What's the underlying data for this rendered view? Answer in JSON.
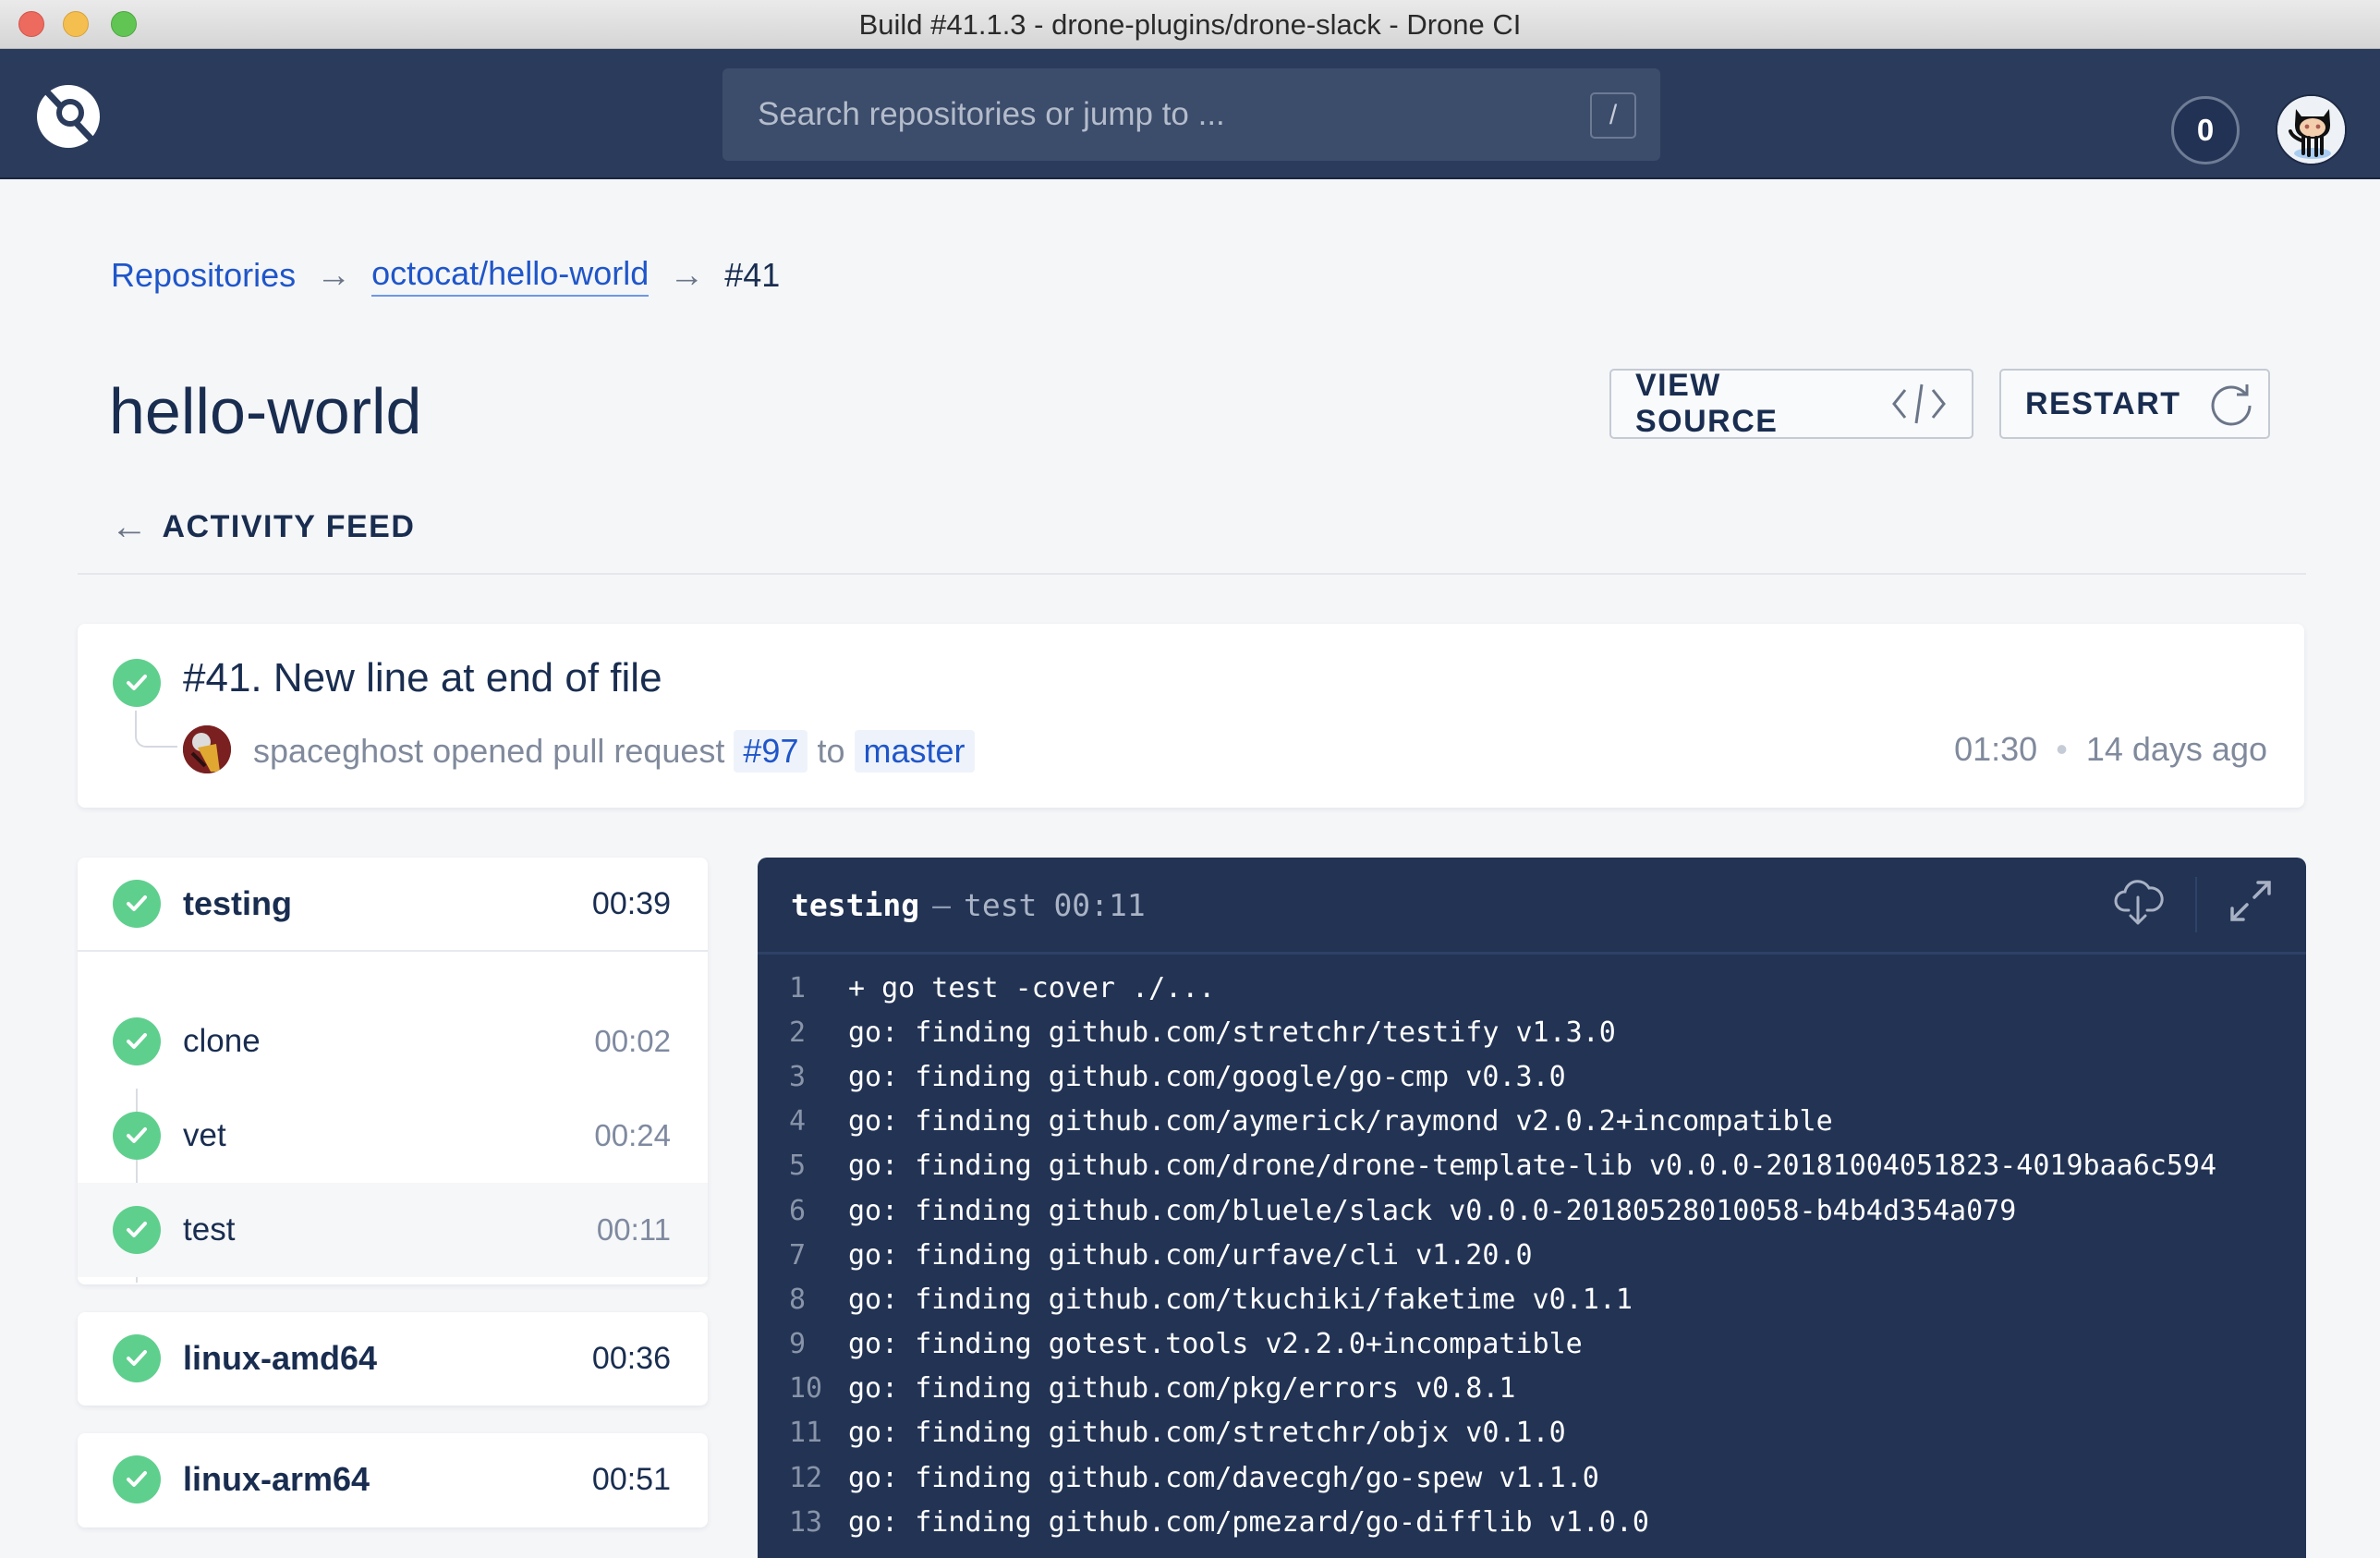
{
  "window": {
    "title": "Build #41.1.3 - drone-plugins/drone-slack - Drone CI"
  },
  "navbar": {
    "logo": "drone-logo-icon",
    "search_placeholder": "Search repositories or jump to ...",
    "search_shortcut": "/",
    "notification_count": "0",
    "avatar": "octocat-avatar"
  },
  "breadcrumb": {
    "items": [
      "Repositories",
      "octocat/hello-world",
      "#41"
    ],
    "separator": "→"
  },
  "page": {
    "title": "hello-world",
    "view_source_label": "VIEW SOURCE",
    "restart_label": "RESTART",
    "back_label": "ACTIVITY FEED",
    "back_arrow": "←"
  },
  "build": {
    "status": "success",
    "title": "#41. New line at end of file",
    "author": "spaceghost",
    "action": "opened pull request",
    "pr_ref": "#97",
    "to_word": "to",
    "branch": "master",
    "duration": "01:30",
    "time_sep": "•",
    "ago": "14 days ago"
  },
  "stages": [
    {
      "name": "testing",
      "duration": "00:39",
      "status": "success",
      "steps": [
        {
          "name": "clone",
          "duration": "00:02",
          "status": "success"
        },
        {
          "name": "vet",
          "duration": "00:24",
          "status": "success"
        },
        {
          "name": "test",
          "duration": "00:11",
          "status": "success",
          "active": true
        }
      ]
    },
    {
      "name": "linux-amd64",
      "duration": "00:36",
      "status": "success"
    },
    {
      "name": "linux-arm64",
      "duration": "00:51",
      "status": "success"
    }
  ],
  "log": {
    "stage": "testing",
    "separator": "–",
    "step": "test",
    "time": "00:11",
    "download_icon": "cloud-download-icon",
    "expand_icon": "expand-icon",
    "lines": [
      {
        "n": "1",
        "text": "+ go test -cover ./..."
      },
      {
        "n": "2",
        "text": "go: finding github.com/stretchr/testify v1.3.0"
      },
      {
        "n": "3",
        "text": "go: finding github.com/google/go-cmp v0.3.0"
      },
      {
        "n": "4",
        "text": "go: finding github.com/aymerick/raymond v2.0.2+incompatible"
      },
      {
        "n": "5",
        "text": "go: finding github.com/drone/drone-template-lib v0.0.0-20181004051823-4019baa6c594"
      },
      {
        "n": "6",
        "text": "go: finding github.com/bluele/slack v0.0.0-20180528010058-b4b4d354a079"
      },
      {
        "n": "7",
        "text": "go: finding github.com/urfave/cli v1.20.0"
      },
      {
        "n": "8",
        "text": "go: finding github.com/tkuchiki/faketime v0.1.1"
      },
      {
        "n": "9",
        "text": "go: finding gotest.tools v2.2.0+incompatible"
      },
      {
        "n": "10",
        "text": "go: finding github.com/pkg/errors v0.8.1"
      },
      {
        "n": "11",
        "text": "go: finding github.com/stretchr/objx v0.1.0"
      },
      {
        "n": "12",
        "text": "go: finding github.com/davecgh/go-spew v1.1.0"
      },
      {
        "n": "13",
        "text": "go: finding github.com/pmezard/go-difflib v1.0.0"
      }
    ]
  },
  "colors": {
    "navbar": "#2b3b5b",
    "success": "#5fcf8e",
    "link": "#1f56c9",
    "log_bg": "#223354",
    "page_bg": "#f5f6f8"
  }
}
